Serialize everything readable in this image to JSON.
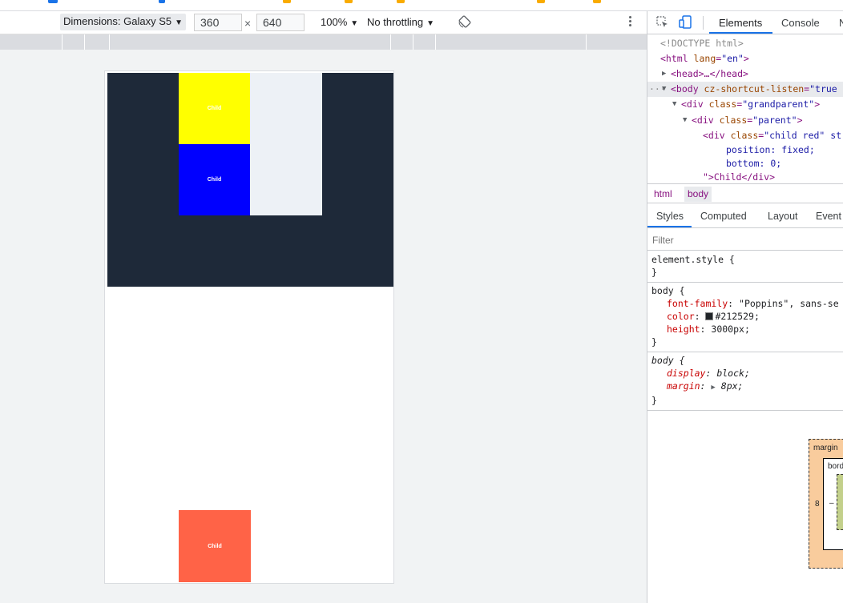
{
  "toolbar": {
    "dimensions_label": "Dimensions: Galaxy S5",
    "width_value": "360",
    "times": "×",
    "height_value": "640",
    "zoom_label": "100%",
    "throttle_label": "No throttling",
    "arrow": "▼"
  },
  "viewport": {
    "child_label": "Child"
  },
  "devtools": {
    "tabs": {
      "elements": "Elements",
      "console": "Console",
      "next": "N"
    },
    "dom": {
      "doctype": "<!DOCTYPE html>",
      "html_open": "<html ",
      "html_attr": "lang",
      "html_val": "\"en\"",
      "head_collapsed": "<head>…</head>",
      "ellipsis": "···",
      "body_tag": "<body ",
      "body_attr": "cz-shortcut-listen",
      "body_val": "\"true",
      "grandparent_tag": "<div ",
      "class_attr": "class",
      "grandparent_val": "\"grandparent\"",
      "parent_val": "\"parent\"",
      "child_val": "\"child red\" st",
      "close_bracket": ">",
      "inline_pos": "position: fixed;",
      "inline_bottom": "bottom: 0;",
      "child_close_tail": "\">Child</div>"
    },
    "breadcrumbs": [
      "html",
      "body"
    ],
    "style_tabs": [
      "Styles",
      "Computed",
      "Layout",
      "Event"
    ],
    "filter_placeholder": "Filter",
    "rules": {
      "element_style": "element.style {",
      "close": "}",
      "body_selector": "body {",
      "font_family_prop": "font-family",
      "font_family_val": "\"Poppins\", sans-se",
      "color_prop": "color",
      "color_val": "#212529",
      "height_prop": "height",
      "height_val": "3000px;",
      "display_prop": "display",
      "display_val": "block;",
      "margin_prop": "margin",
      "margin_val": "8px;"
    },
    "box_model": {
      "margin_label": "margin",
      "border_label": "bord",
      "margin_left": "8",
      "dash": "–"
    }
  }
}
